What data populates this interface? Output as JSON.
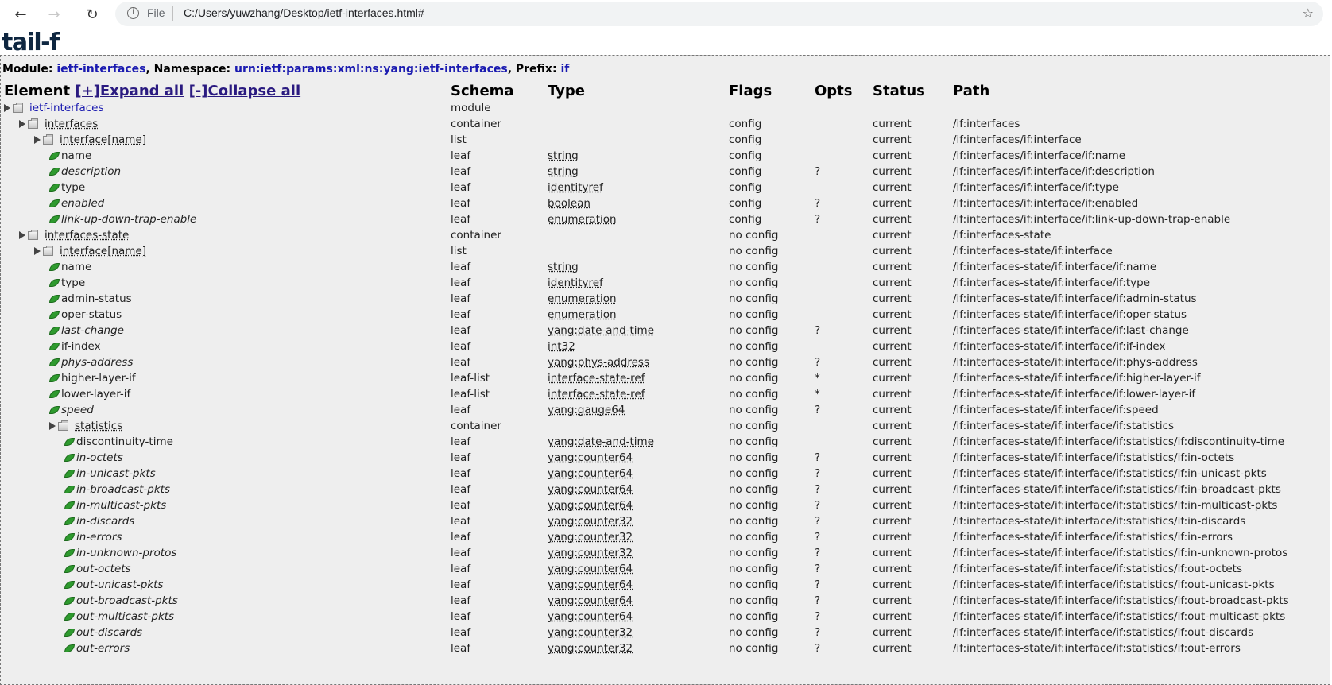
{
  "browser": {
    "file_label": "File",
    "url": "C:/Users/yuwzhang/Desktop/ietf-interfaces.html#"
  },
  "logo": {
    "text": "tail-f"
  },
  "module_line": {
    "module_label": "Module: ",
    "module_value": "ietf-interfaces",
    "namespace_label": ", Namespace: ",
    "namespace_value": "urn:ietf:params:xml:ns:yang:ietf-interfaces",
    "prefix_label": ", Prefix: ",
    "prefix_value": "if"
  },
  "headers": {
    "element": "Element",
    "expand_all": "[+]Expand all",
    "collapse_all": "[-]Collapse all",
    "schema": "Schema",
    "type": "Type",
    "flags": "Flags",
    "opts": "Opts",
    "status": "Status",
    "path": "Path"
  },
  "rows": [
    {
      "name": "ietf-interfaces",
      "kind": "module",
      "level": 0,
      "schema": "module",
      "type": "",
      "flags": "",
      "opts": "",
      "status": "",
      "path": ""
    },
    {
      "name": "interfaces",
      "kind": "container",
      "level": 1,
      "schema": "container",
      "type": "",
      "flags": "config",
      "opts": "",
      "status": "current",
      "path": "/if:interfaces"
    },
    {
      "name": "interface[name]",
      "kind": "container",
      "level": 2,
      "schema": "list",
      "type": "",
      "flags": "config",
      "opts": "",
      "status": "current",
      "path": "/if:interfaces/if:interface"
    },
    {
      "name": "name",
      "kind": "leaf",
      "level": 3,
      "italic": false,
      "schema": "leaf",
      "type": "string",
      "flags": "config",
      "opts": "",
      "status": "current",
      "path": "/if:interfaces/if:interface/if:name"
    },
    {
      "name": "description",
      "kind": "leaf",
      "level": 3,
      "italic": true,
      "schema": "leaf",
      "type": "string",
      "flags": "config",
      "opts": "?",
      "status": "current",
      "path": "/if:interfaces/if:interface/if:description"
    },
    {
      "name": "type",
      "kind": "leaf",
      "level": 3,
      "italic": false,
      "schema": "leaf",
      "type": "identityref",
      "flags": "config",
      "opts": "",
      "status": "current",
      "path": "/if:interfaces/if:interface/if:type"
    },
    {
      "name": "enabled",
      "kind": "leaf",
      "level": 3,
      "italic": true,
      "schema": "leaf",
      "type": "boolean",
      "flags": "config",
      "opts": "?",
      "status": "current",
      "path": "/if:interfaces/if:interface/if:enabled"
    },
    {
      "name": "link-up-down-trap-enable",
      "kind": "leaf",
      "level": 3,
      "italic": true,
      "schema": "leaf",
      "type": "enumeration",
      "flags": "config",
      "opts": "?",
      "status": "current",
      "path": "/if:interfaces/if:interface/if:link-up-down-trap-enable"
    },
    {
      "name": "interfaces-state",
      "kind": "container",
      "level": 1,
      "schema": "container",
      "type": "",
      "flags": "no config",
      "opts": "",
      "status": "current",
      "path": "/if:interfaces-state"
    },
    {
      "name": "interface[name]",
      "kind": "container",
      "level": 2,
      "schema": "list",
      "type": "",
      "flags": "no config",
      "opts": "",
      "status": "current",
      "path": "/if:interfaces-state/if:interface"
    },
    {
      "name": "name",
      "kind": "leaf",
      "level": 3,
      "italic": false,
      "schema": "leaf",
      "type": "string",
      "flags": "no config",
      "opts": "",
      "status": "current",
      "path": "/if:interfaces-state/if:interface/if:name"
    },
    {
      "name": "type",
      "kind": "leaf",
      "level": 3,
      "italic": false,
      "schema": "leaf",
      "type": "identityref",
      "flags": "no config",
      "opts": "",
      "status": "current",
      "path": "/if:interfaces-state/if:interface/if:type"
    },
    {
      "name": "admin-status",
      "kind": "leaf",
      "level": 3,
      "italic": false,
      "schema": "leaf",
      "type": "enumeration",
      "flags": "no config",
      "opts": "",
      "status": "current",
      "path": "/if:interfaces-state/if:interface/if:admin-status"
    },
    {
      "name": "oper-status",
      "kind": "leaf",
      "level": 3,
      "italic": false,
      "schema": "leaf",
      "type": "enumeration",
      "flags": "no config",
      "opts": "",
      "status": "current",
      "path": "/if:interfaces-state/if:interface/if:oper-status"
    },
    {
      "name": "last-change",
      "kind": "leaf",
      "level": 3,
      "italic": true,
      "schema": "leaf",
      "type": "yang:date-and-time",
      "flags": "no config",
      "opts": "?",
      "status": "current",
      "path": "/if:interfaces-state/if:interface/if:last-change"
    },
    {
      "name": "if-index",
      "kind": "leaf",
      "level": 3,
      "italic": false,
      "schema": "leaf",
      "type": "int32",
      "flags": "no config",
      "opts": "",
      "status": "current",
      "path": "/if:interfaces-state/if:interface/if:if-index"
    },
    {
      "name": "phys-address",
      "kind": "leaf",
      "level": 3,
      "italic": true,
      "schema": "leaf",
      "type": "yang:phys-address",
      "flags": "no config",
      "opts": "?",
      "status": "current",
      "path": "/if:interfaces-state/if:interface/if:phys-address"
    },
    {
      "name": "higher-layer-if",
      "kind": "leaf",
      "level": 3,
      "italic": false,
      "schema": "leaf-list",
      "type": "interface-state-ref",
      "flags": "no config",
      "opts": "*",
      "status": "current",
      "path": "/if:interfaces-state/if:interface/if:higher-layer-if"
    },
    {
      "name": "lower-layer-if",
      "kind": "leaf",
      "level": 3,
      "italic": false,
      "schema": "leaf-list",
      "type": "interface-state-ref",
      "flags": "no config",
      "opts": "*",
      "status": "current",
      "path": "/if:interfaces-state/if:interface/if:lower-layer-if"
    },
    {
      "name": "speed",
      "kind": "leaf",
      "level": 3,
      "italic": true,
      "schema": "leaf",
      "type": "yang:gauge64",
      "flags": "no config",
      "opts": "?",
      "status": "current",
      "path": "/if:interfaces-state/if:interface/if:speed"
    },
    {
      "name": "statistics",
      "kind": "container",
      "level": 3,
      "schema": "container",
      "type": "",
      "flags": "no config",
      "opts": "",
      "status": "current",
      "path": "/if:interfaces-state/if:interface/if:statistics"
    },
    {
      "name": "discontinuity-time",
      "kind": "leaf",
      "level": 4,
      "italic": false,
      "schema": "leaf",
      "type": "yang:date-and-time",
      "flags": "no config",
      "opts": "",
      "status": "current",
      "path": "/if:interfaces-state/if:interface/if:statistics/if:discontinuity-time"
    },
    {
      "name": "in-octets",
      "kind": "leaf",
      "level": 4,
      "italic": true,
      "schema": "leaf",
      "type": "yang:counter64",
      "flags": "no config",
      "opts": "?",
      "status": "current",
      "path": "/if:interfaces-state/if:interface/if:statistics/if:in-octets"
    },
    {
      "name": "in-unicast-pkts",
      "kind": "leaf",
      "level": 4,
      "italic": true,
      "schema": "leaf",
      "type": "yang:counter64",
      "flags": "no config",
      "opts": "?",
      "status": "current",
      "path": "/if:interfaces-state/if:interface/if:statistics/if:in-unicast-pkts"
    },
    {
      "name": "in-broadcast-pkts",
      "kind": "leaf",
      "level": 4,
      "italic": true,
      "schema": "leaf",
      "type": "yang:counter64",
      "flags": "no config",
      "opts": "?",
      "status": "current",
      "path": "/if:interfaces-state/if:interface/if:statistics/if:in-broadcast-pkts"
    },
    {
      "name": "in-multicast-pkts",
      "kind": "leaf",
      "level": 4,
      "italic": true,
      "schema": "leaf",
      "type": "yang:counter64",
      "flags": "no config",
      "opts": "?",
      "status": "current",
      "path": "/if:interfaces-state/if:interface/if:statistics/if:in-multicast-pkts"
    },
    {
      "name": "in-discards",
      "kind": "leaf",
      "level": 4,
      "italic": true,
      "schema": "leaf",
      "type": "yang:counter32",
      "flags": "no config",
      "opts": "?",
      "status": "current",
      "path": "/if:interfaces-state/if:interface/if:statistics/if:in-discards"
    },
    {
      "name": "in-errors",
      "kind": "leaf",
      "level": 4,
      "italic": true,
      "schema": "leaf",
      "type": "yang:counter32",
      "flags": "no config",
      "opts": "?",
      "status": "current",
      "path": "/if:interfaces-state/if:interface/if:statistics/if:in-errors"
    },
    {
      "name": "in-unknown-protos",
      "kind": "leaf",
      "level": 4,
      "italic": true,
      "schema": "leaf",
      "type": "yang:counter32",
      "flags": "no config",
      "opts": "?",
      "status": "current",
      "path": "/if:interfaces-state/if:interface/if:statistics/if:in-unknown-protos"
    },
    {
      "name": "out-octets",
      "kind": "leaf",
      "level": 4,
      "italic": true,
      "schema": "leaf",
      "type": "yang:counter64",
      "flags": "no config",
      "opts": "?",
      "status": "current",
      "path": "/if:interfaces-state/if:interface/if:statistics/if:out-octets"
    },
    {
      "name": "out-unicast-pkts",
      "kind": "leaf",
      "level": 4,
      "italic": true,
      "schema": "leaf",
      "type": "yang:counter64",
      "flags": "no config",
      "opts": "?",
      "status": "current",
      "path": "/if:interfaces-state/if:interface/if:statistics/if:out-unicast-pkts"
    },
    {
      "name": "out-broadcast-pkts",
      "kind": "leaf",
      "level": 4,
      "italic": true,
      "schema": "leaf",
      "type": "yang:counter64",
      "flags": "no config",
      "opts": "?",
      "status": "current",
      "path": "/if:interfaces-state/if:interface/if:statistics/if:out-broadcast-pkts"
    },
    {
      "name": "out-multicast-pkts",
      "kind": "leaf",
      "level": 4,
      "italic": true,
      "schema": "leaf",
      "type": "yang:counter64",
      "flags": "no config",
      "opts": "?",
      "status": "current",
      "path": "/if:interfaces-state/if:interface/if:statistics/if:out-multicast-pkts"
    },
    {
      "name": "out-discards",
      "kind": "leaf",
      "level": 4,
      "italic": true,
      "schema": "leaf",
      "type": "yang:counter32",
      "flags": "no config",
      "opts": "?",
      "status": "current",
      "path": "/if:interfaces-state/if:interface/if:statistics/if:out-discards"
    },
    {
      "name": "out-errors",
      "kind": "leaf",
      "level": 4,
      "italic": true,
      "schema": "leaf",
      "type": "yang:counter32",
      "flags": "no config",
      "opts": "?",
      "status": "current",
      "path": "/if:interfaces-state/if:interface/if:statistics/if:out-errors"
    }
  ],
  "icons": {
    "back": "back-arrow-icon",
    "forward": "forward-arrow-icon",
    "reload": "reload-icon",
    "info": "info-icon",
    "star": "bookmark-star-icon",
    "node": "folder-icon",
    "leaf": "leaf-icon",
    "expander": "expand-triangle-icon"
  },
  "colors": {
    "link_blue": "#1a1ab0",
    "header_link": "#2a1a80",
    "leaf_green": "#2e9a2e",
    "panel_bg": "#eeeeee"
  }
}
